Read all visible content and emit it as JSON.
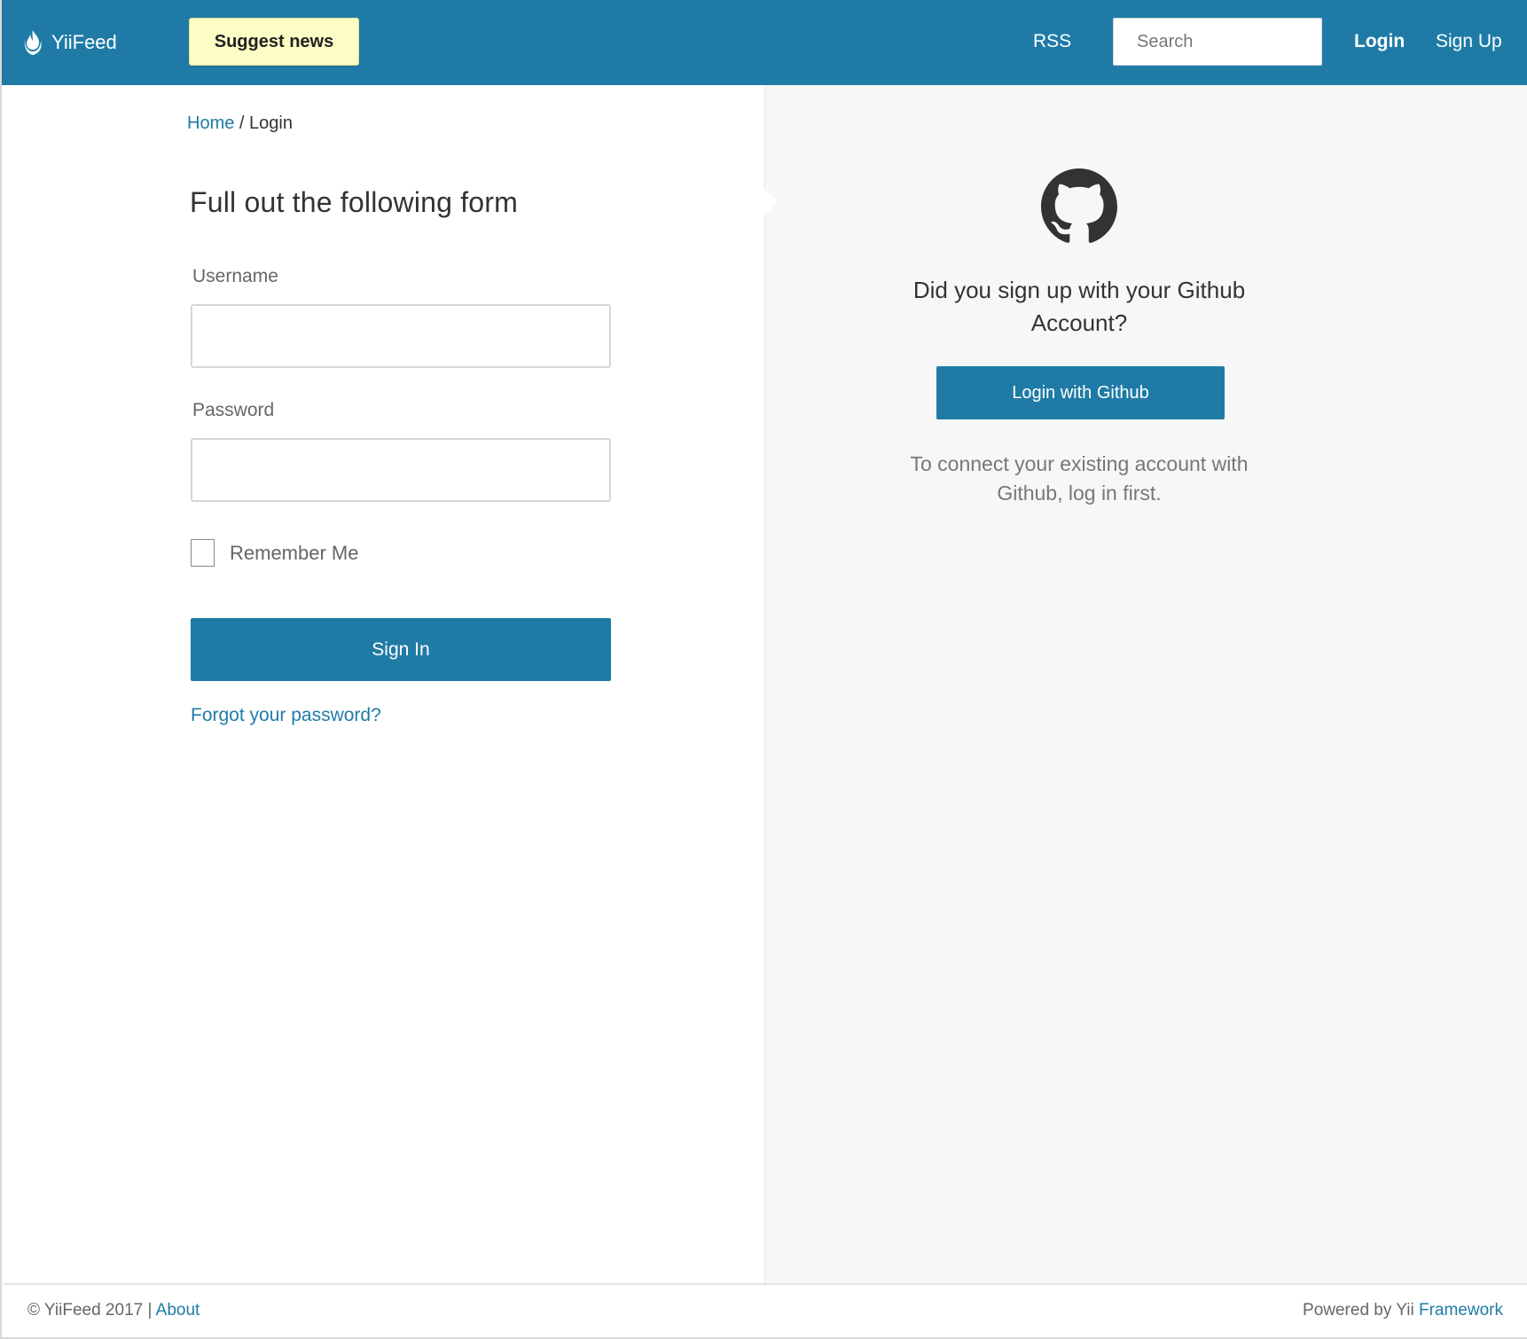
{
  "navbar": {
    "brand": "YiiFeed",
    "suggest_label": "Suggest news",
    "rss_label": "RSS",
    "search_placeholder": "Search",
    "login_label": "Login",
    "signup_label": "Sign Up"
  },
  "breadcrumb": {
    "home": "Home",
    "separator": " / ",
    "current": "Login"
  },
  "form": {
    "title": "Full out the following form",
    "username_label": "Username",
    "username_value": "",
    "password_label": "Password",
    "password_value": "",
    "remember_label": "Remember Me",
    "remember_checked": false,
    "submit_label": "Sign In",
    "forgot_label": "Forgot your password?"
  },
  "github": {
    "icon": "github-icon",
    "question": "Did you sign up with your Github Account?",
    "button_label": "Login with Github",
    "note": "To connect your existing account with Github, log in first."
  },
  "footer": {
    "copyright": "© YiiFeed 2017 | ",
    "about_label": "About",
    "powered_prefix": "Powered by Yii ",
    "framework_label": "Framework"
  },
  "colors": {
    "primary": "#1f7ba6",
    "suggest_bg": "#fbfdc4",
    "right_panel_bg": "#f7f7f7"
  }
}
